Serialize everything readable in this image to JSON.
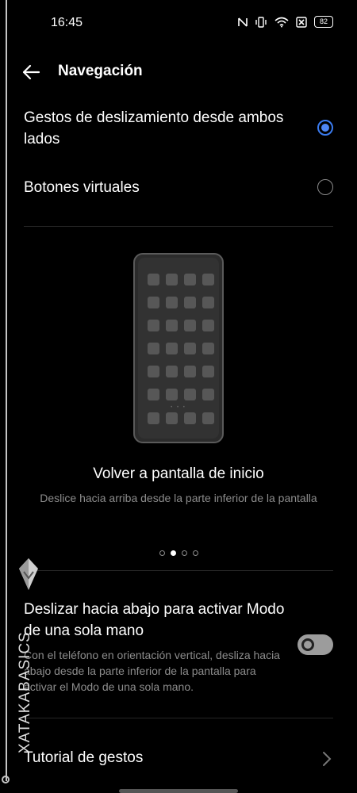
{
  "status_bar": {
    "time": "16:45",
    "battery": "82"
  },
  "header": {
    "title": "Navegación"
  },
  "options": [
    {
      "label": "Gestos de deslizamiento desde ambos lados",
      "selected": true
    },
    {
      "label": "Botones virtuales",
      "selected": false
    }
  ],
  "illustration": {
    "title": "Volver a pantalla de inicio",
    "description": "Deslice hacia arriba desde la parte inferior de la pantalla",
    "page_count": 4,
    "active_page": 2
  },
  "one_hand": {
    "title": "Deslizar hacia abajo para activar Modo de una sola mano",
    "description": "Con el teléfono en orientación vertical, desliza hacia abajo desde la parte inferior de la pantalla para activar el Modo de una sola mano.",
    "enabled": false
  },
  "tutorial": {
    "label": "Tutorial de gestos"
  },
  "watermark": {
    "text": "XATAKABASICS"
  },
  "colors": {
    "accent": "#4d86f4",
    "background": "#000000"
  }
}
